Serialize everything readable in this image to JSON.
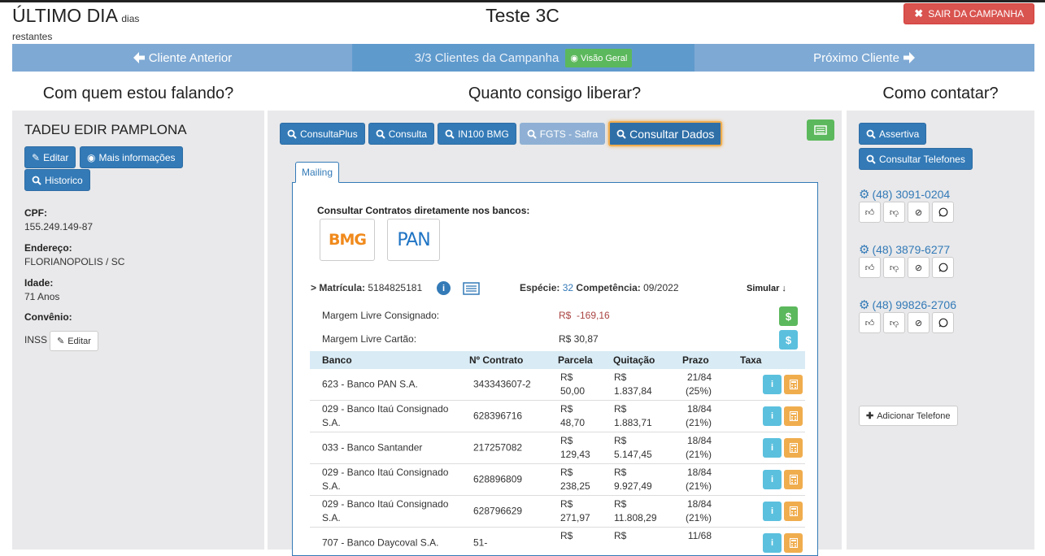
{
  "header": {
    "deadline_big": "ÚLTIMO DIA",
    "deadline_small": "dias",
    "deadline_rest": "restantes",
    "title": "Teste 3C",
    "exit_label": "SAIR DA CAMPANHA"
  },
  "nav": {
    "prev_label": "Cliente Anterior",
    "progress_label": "3/3 Clientes da Campanha",
    "overview_label": "Visão Geral",
    "next_label": "Próximo Cliente"
  },
  "sections": {
    "left_title": "Com quem estou falando?",
    "mid_title": "Quanto consigo liberar?",
    "right_title": "Como contatar?"
  },
  "client": {
    "name": "TADEU EDIR PAMPLONA",
    "edit_label": "Editar",
    "more_info_label": "Mais informações",
    "history_label": "Historico",
    "cpf_label": "CPF:",
    "cpf": "155.249.149-87",
    "address_label": "Endereço:",
    "address": "FLORIANOPOLIS / SC",
    "age_label": "Idade:",
    "age": "71 Anos",
    "agreement_label": "Convênio:",
    "agreement": "INSS",
    "agreement_edit_label": "Editar"
  },
  "toolbar": {
    "buttons": [
      "ConsultaPlus",
      "Consulta",
      "IN100 BMG",
      "FGTS - Safra",
      "Consultar Dados"
    ]
  },
  "mailing": {
    "tab_label": "Mailing",
    "banks_heading": "Consultar Contratos diretamente nos bancos:",
    "bank_logos": [
      "BMG",
      "PAN"
    ],
    "matricula_label": "> Matrícula:",
    "matricula": "5184825181",
    "especie_label": "Espécie:",
    "especie": "32",
    "competencia_label": "Competência:",
    "competencia": "09/2022",
    "simular_label": "Simular ↓",
    "margem_consignado_label": "Margem Livre Consignado:",
    "margem_consignado": "R$  -169,16",
    "margem_cartao_label": "Margem Livre Cartão:",
    "margem_cartao": "R$ 30,87",
    "columns": [
      "Banco",
      "Nº Contrato",
      "Parcela",
      "Quitação",
      "Prazo",
      "Taxa"
    ],
    "rows": [
      {
        "banco": "623 - Banco PAN S.A.",
        "contrato": "343343607-2",
        "parcela": [
          "R$",
          "50,00"
        ],
        "quitacao": [
          "R$",
          "1.837,84"
        ],
        "prazo": [
          "21/84",
          "(25%)"
        ]
      },
      {
        "banco": "029 - Banco Itaú Consignado S.A.",
        "contrato": "628396716",
        "parcela": [
          "R$",
          "48,70"
        ],
        "quitacao": [
          "R$",
          "1.883,71"
        ],
        "prazo": [
          "18/84",
          "(21%)"
        ]
      },
      {
        "banco": "033 - Banco Santander",
        "contrato": "217257082",
        "parcela": [
          "R$",
          "129,43"
        ],
        "quitacao": [
          "R$",
          "5.147,45"
        ],
        "prazo": [
          "18/84",
          "(21%)"
        ]
      },
      {
        "banco": "029 - Banco Itaú Consignado S.A.",
        "contrato": "628896809",
        "parcela": [
          "R$",
          "238,25"
        ],
        "quitacao": [
          "R$",
          "9.927,49"
        ],
        "prazo": [
          "18/84",
          "(21%)"
        ]
      },
      {
        "banco": "029 - Banco Itaú Consignado S.A.",
        "contrato": "628796629",
        "parcela": [
          "R$",
          "271,97"
        ],
        "quitacao": [
          "R$",
          "11.808,29"
        ],
        "prazo": [
          "18/84",
          "(21%)"
        ]
      },
      {
        "banco": "707 - Banco Daycoval S.A.",
        "contrato": "51-",
        "parcela": [
          "R$",
          ""
        ],
        "quitacao": [
          "R$",
          ""
        ],
        "prazo": [
          "11/68",
          ""
        ]
      }
    ]
  },
  "contact": {
    "assertiva_label": "Assertiva",
    "consult_phones_label": "Consultar Telefones",
    "phones": [
      "(48) 3091-0204",
      "(48) 3879-6277",
      "(48) 99826-2706"
    ],
    "add_phone_label": "Adicionar Telefone"
  },
  "colors": {
    "primary": "#337ab7",
    "danger": "#d9534f",
    "success": "#5cb85c",
    "info": "#5bc0de",
    "warning": "#f0ad4e",
    "nav": "#7ea9d4",
    "panel": "#e9e9eb"
  }
}
